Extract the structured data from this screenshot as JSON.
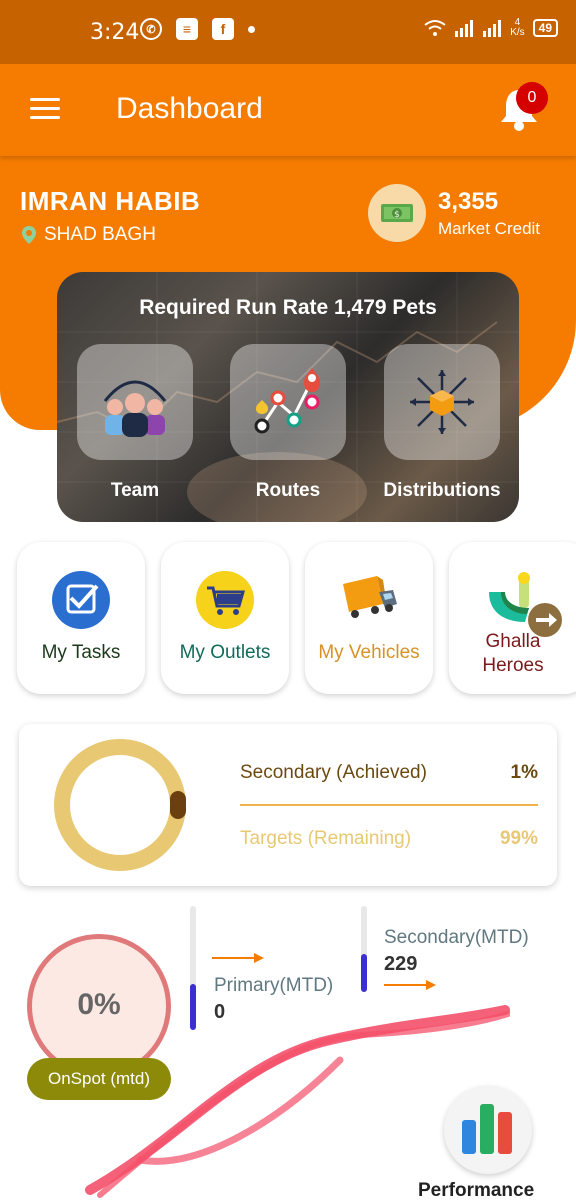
{
  "status_bar": {
    "time": "3:24",
    "speed_top": "4",
    "speed_unit": "K/s",
    "battery": "49"
  },
  "header": {
    "title": "Dashboard",
    "notification_count": "0"
  },
  "user": {
    "name": "IMRAN HABIB",
    "location": "SHAD BAGH"
  },
  "credit": {
    "value": "3,355",
    "label": "Market Credit"
  },
  "run_rate": {
    "title": "Required Run Rate 1,479 Pets",
    "tiles": [
      {
        "label": "Team",
        "icon": "team-icon"
      },
      {
        "label": "Routes",
        "icon": "routes-icon"
      },
      {
        "label": "Distributions",
        "icon": "distributions-icon"
      }
    ]
  },
  "quick_tiles": [
    {
      "label": "My Tasks",
      "icon": "tasks-icon",
      "color": "#1b3a1b"
    },
    {
      "label": "My Outlets",
      "icon": "outlets-icon",
      "color": "#0f6b5a"
    },
    {
      "label": "My Vehicles",
      "icon": "vehicles-icon",
      "color": "#d89224"
    },
    {
      "label": "Ghalla\nHeroes",
      "icon": "ghalla-heroes-icon",
      "color": "#7a1b1b"
    }
  ],
  "secondary_card": {
    "achieved_label": "Secondary (Achieved)",
    "achieved_value": "1%",
    "achieved_fraction": 0.01,
    "remaining_label": "Targets (Remaining)",
    "remaining_value": "99%"
  },
  "stats": {
    "onspot_value": "0%",
    "onspot_label": "OnSpot (mtd)",
    "primary_label": "Primary(MTD)",
    "primary_value": "0",
    "secondary_label": "Secondary(MTD)",
    "secondary_value": "229",
    "performance_label": "Performance"
  },
  "colors": {
    "brand": "#f57c00",
    "status_bar": "#c76200",
    "badge": "#d50000"
  }
}
